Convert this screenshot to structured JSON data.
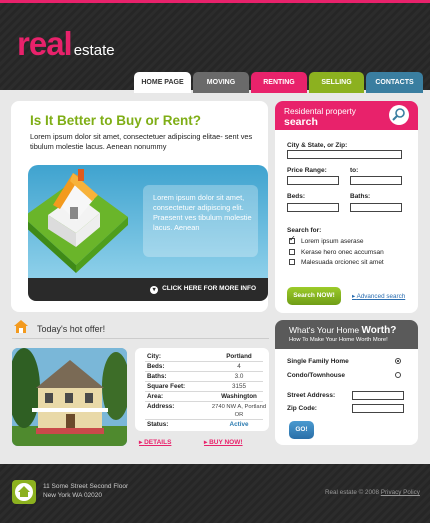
{
  "brand": {
    "logo_main": "real",
    "logo_sub": "estate"
  },
  "nav": {
    "tabs": [
      {
        "label": "HOME PAGE"
      },
      {
        "label": "MOVING"
      },
      {
        "label": "RENTING"
      },
      {
        "label": "SELLING"
      },
      {
        "label": "CONTACTS"
      }
    ]
  },
  "hero": {
    "title": "Is It Better to Buy or Rent?",
    "intro": "Lorem ipsum dolor sit amet, consectetuer adipiscing elitae- sent ves tibulum molestie lacus. Aenean nonummy",
    "box_text": "Lorem ipsum dolor sit amet, consectetuer adipiscing elit. Praesent ves tibulum molestie lacus. Aenean",
    "more_label": "CLICK HERE FOR MORE INFO"
  },
  "search": {
    "heading_line1": "Residental property",
    "heading_line2": "search",
    "city_label": "City & State, or Zip:",
    "price_label": "Price Range:",
    "to_label": "to:",
    "beds_label": "Beds:",
    "baths_label": "Baths:",
    "search_for_label": "Search for:",
    "options": [
      {
        "label": "Lorem ipsum aserase",
        "checked": true
      },
      {
        "label": "Kerase hero onec accumsan",
        "checked": false
      },
      {
        "label": "Malesuada orcionec sit amet",
        "checked": false
      }
    ],
    "button_label": "Search NOW!",
    "advanced_label": "Advanced search"
  },
  "offer": {
    "title": "Today's hot offer!",
    "rows": [
      {
        "key": "City:",
        "value": "Portland"
      },
      {
        "key": "Beds:",
        "value": "4"
      },
      {
        "key": "Baths:",
        "value": "3.0"
      },
      {
        "key": "Square Feet:",
        "value": "3155"
      },
      {
        "key": "Area:",
        "value": "Washington"
      },
      {
        "key": "Address:",
        "value": "2740 NW A, Portland OR"
      },
      {
        "key": "Status:",
        "value": "Active"
      }
    ],
    "details_label": "DETAILS",
    "buy_label": "BUY NOW!"
  },
  "worth": {
    "heading_pre": "What's Your Home ",
    "heading_bold": "Worth?",
    "subheading": "How To Make Your Home Worth More!",
    "types": [
      {
        "label": "Single Family Home",
        "selected": true
      },
      {
        "label": "Condo/Townhouse",
        "selected": false
      }
    ],
    "street_label": "Street Address:",
    "zip_label": "Zip Code:",
    "go_label": "GO!"
  },
  "footer": {
    "address_line1": "11 Some Street Second Floor",
    "address_line2": "New York WA 02020",
    "copyright": "Real estate  © 2008 ",
    "privacy_label": "Privacy Policy"
  },
  "colors": {
    "accent_pink": "#e8226b",
    "accent_green": "#8cb11f",
    "accent_blue": "#3a7ea0",
    "dark": "#2c2c2c"
  }
}
